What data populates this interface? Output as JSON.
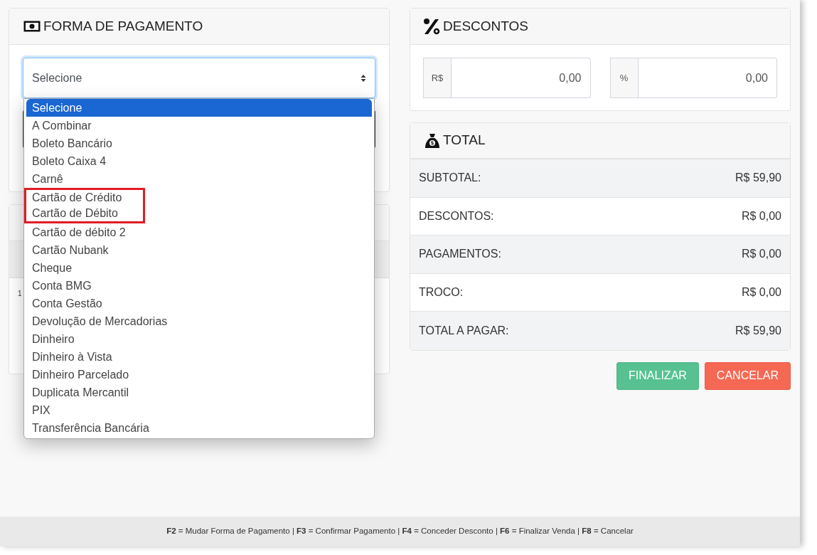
{
  "payment": {
    "title": "FORMA DE PAGAMENTO",
    "select": {
      "value": "Selecione",
      "expanded": true
    },
    "options": [
      {
        "label": "Selecione",
        "selected": true,
        "annotated": false
      },
      {
        "label": "A Combinar",
        "selected": false,
        "annotated": false
      },
      {
        "label": "Boleto Bancário",
        "selected": false,
        "annotated": false
      },
      {
        "label": "Boleto Caixa 4",
        "selected": false,
        "annotated": false
      },
      {
        "label": "Carnê",
        "selected": false,
        "annotated": false
      },
      {
        "label": "Cartão de Crédito",
        "selected": false,
        "annotated": true
      },
      {
        "label": "Cartão de Débito",
        "selected": false,
        "annotated": true
      },
      {
        "label": "Cartão de débito 2",
        "selected": false,
        "annotated": false
      },
      {
        "label": "Cartão Nubank",
        "selected": false,
        "annotated": false
      },
      {
        "label": "Cheque",
        "selected": false,
        "annotated": false
      },
      {
        "label": "Conta BMG",
        "selected": false,
        "annotated": false
      },
      {
        "label": "Conta Gestão",
        "selected": false,
        "annotated": false
      },
      {
        "label": "Devolução de Mercadorias",
        "selected": false,
        "annotated": false
      },
      {
        "label": "Dinheiro",
        "selected": false,
        "annotated": false
      },
      {
        "label": "Dinheiro à Vista",
        "selected": false,
        "annotated": false
      },
      {
        "label": "Dinheiro Parcelado",
        "selected": false,
        "annotated": false
      },
      {
        "label": "Duplicata Mercantil",
        "selected": false,
        "annotated": false
      },
      {
        "label": "PIX",
        "selected": false,
        "annotated": false
      },
      {
        "label": "Transferência Bancária",
        "selected": false,
        "annotated": false
      }
    ]
  },
  "payments_table": {
    "rows": [
      [
        "1"
      ]
    ]
  },
  "discounts": {
    "title": "DESCONTOS",
    "fields": [
      {
        "prefix": "R$",
        "value": "0,00"
      },
      {
        "prefix": "%",
        "value": "0,00"
      }
    ]
  },
  "total": {
    "title": "TOTAL",
    "rows": [
      {
        "label": "SUBTOTAL:",
        "value": "R$ 59,90"
      },
      {
        "label": "DESCONTOS:",
        "value": "R$ 0,00"
      },
      {
        "label": "PAGAMENTOS:",
        "value": "R$ 0,00"
      },
      {
        "label": "TROCO:",
        "value": "R$ 0,00"
      },
      {
        "label": "TOTAL A PAGAR:",
        "value": "R$ 59,90"
      }
    ]
  },
  "buttons": [
    {
      "label": "FINALIZAR",
      "kind": "confirm"
    },
    {
      "label": "CANCELAR",
      "kind": "cancel"
    }
  ],
  "shortcuts": [
    {
      "key": "F2",
      "action": "= Mudar Forma de Pagamento"
    },
    {
      "key": "F3",
      "action": "= Confirmar Pagamento"
    },
    {
      "key": "F4",
      "action": "= Conceder Desconto"
    },
    {
      "key": "F6",
      "action": "= Finalizar Venda"
    },
    {
      "key": "F8",
      "action": "= Cancelar"
    }
  ],
  "shortcut_separator": "|"
}
